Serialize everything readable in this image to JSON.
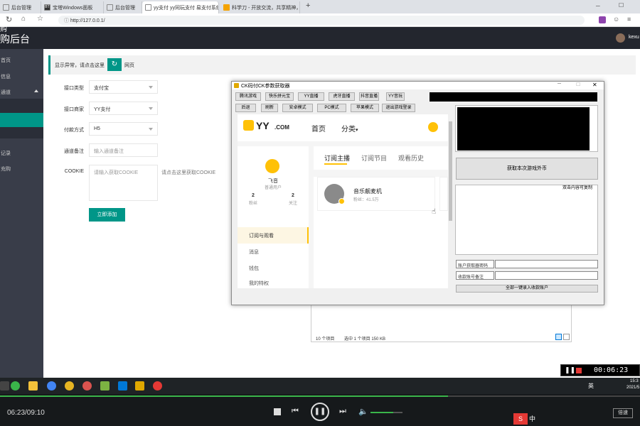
{
  "browser": {
    "tabs": [
      "后台管理",
      "宝塔Windows面板",
      "后台管理",
      "yy支付 yy同玩支付 易支付系统",
      "科学刀 - 开放交流，共享精神，志"
    ],
    "url": "http://127.0.0.1/",
    "new_tab": "+"
  },
  "admin": {
    "title_line1": "购",
    "title_line2": "购后台",
    "username": "kexu",
    "sidebar_items": [
      "首页",
      "信息",
      "通道",
      "记录",
      "充购"
    ],
    "notice": "显示异常，请点击这里",
    "notice_link": "网页",
    "form": {
      "type_label": "接口类型",
      "type_value": "支付宝",
      "vendor_label": "接口商家",
      "vendor_value": "YY支付",
      "method_label": "付款方式",
      "method_value": "H5",
      "remark_label": "通道备注",
      "remark_placeholder": "输入通道备注",
      "cookie_label": "COOKIE",
      "cookie_placeholder": "请输入获取COOKIE",
      "cookie_hint": "请点击这里获取COOKIE",
      "submit": "立即添加"
    }
  },
  "explorer": {
    "count": "10 个项目",
    "selected": "选中 1 个项目  150 KB"
  },
  "tool": {
    "title": "CK码付CK参数获取器",
    "buttons_row1": [
      "腾讯游戏",
      "快乐拼元宝",
      "YY直播",
      "虎牙直播",
      "抖音直播",
      "YY音玩"
    ],
    "buttons_row2": [
      "后退",
      "刷新",
      "安卓模式",
      "PC模式",
      "苹果模式",
      "退出游戏登录"
    ],
    "get_button": "获取本次游戏外币",
    "hint": "双击内容可复制",
    "field1_label": "账户获取器密码",
    "field2_label": "收款账号备注",
    "bottom_button": "全部一键录入收款账户"
  },
  "yy": {
    "logo_text": "YY",
    "logo_suffix": ".COM",
    "nav_home": "首页",
    "nav_category": "分类",
    "user_name": "飞音",
    "user_level": "普通用户",
    "fans_count": "2",
    "fans_label": "粉丝",
    "follow_count": "2",
    "follow_label": "关注",
    "menu": [
      "订阅与观看",
      "消息",
      "钱包",
      "我的特权"
    ],
    "tabs": [
      "订阅主播",
      "订阅节目",
      "观看历史"
    ],
    "anchor_name": "音乐靓麦机",
    "anchor_fans": "粉丝：41.5万"
  },
  "taskbar": {
    "ime": "中",
    "lang": "英",
    "time": "15:3",
    "date": "2021/5"
  },
  "recorder": {
    "time": "00:06:23"
  },
  "player": {
    "progress": "06:23/09:10",
    "speed": "倍速",
    "progress_fraction": 0.7,
    "volume_fraction": 0.7
  },
  "colors": {
    "teal": "#009688",
    "dark_nav": "#23262e",
    "sidebar": "#393d49",
    "yy_yellow": "#ffc107"
  }
}
